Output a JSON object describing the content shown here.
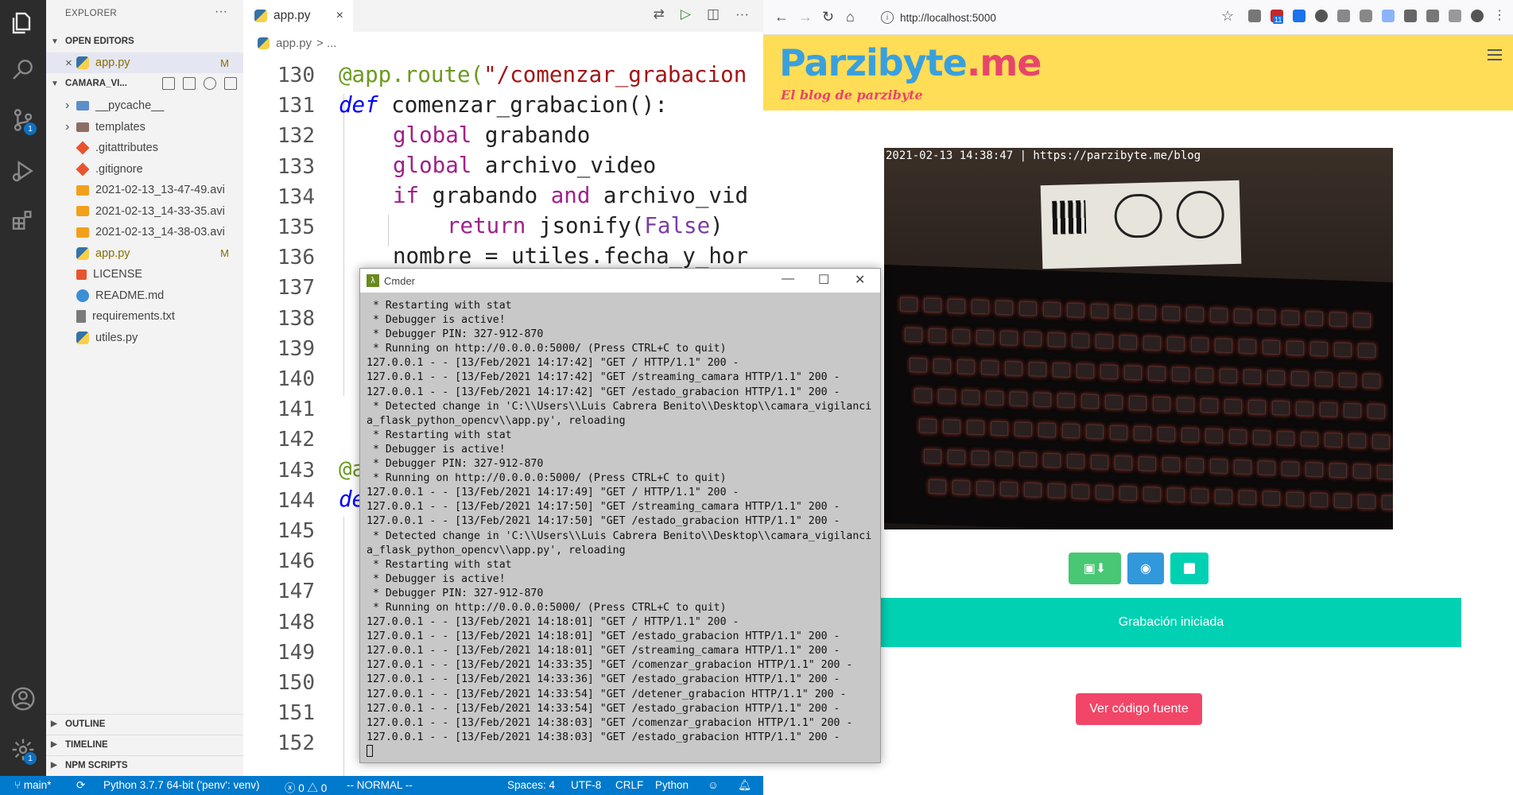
{
  "activity_bar": {
    "items": [
      {
        "icon": "files-icon",
        "active": true
      },
      {
        "icon": "search-icon"
      },
      {
        "icon": "source-control-icon",
        "badge": "1"
      },
      {
        "icon": "run-debug-icon"
      },
      {
        "icon": "extensions-icon"
      }
    ],
    "bottom": [
      {
        "icon": "account-icon"
      },
      {
        "icon": "manage-gear-icon",
        "badge": "1"
      }
    ]
  },
  "sidebar": {
    "title": "EXPLORER",
    "more": "···",
    "open_editors_label": "OPEN EDITORS",
    "open_editors": [
      {
        "name": "app.py",
        "status": "M",
        "close": "×"
      }
    ],
    "project_label": "CAMARA_VI...",
    "files": [
      {
        "name": "__pycache__",
        "type": "folder"
      },
      {
        "name": "templates",
        "type": "folder"
      },
      {
        "name": ".gitattributes",
        "type": "git"
      },
      {
        "name": ".gitignore",
        "type": "git"
      },
      {
        "name": "2021-02-13_13-47-49.avi",
        "type": "avi"
      },
      {
        "name": "2021-02-13_14-33-35.avi",
        "type": "avi"
      },
      {
        "name": "2021-02-13_14-38-03.avi",
        "type": "avi"
      },
      {
        "name": "app.py",
        "type": "py",
        "status": "M"
      },
      {
        "name": "LICENSE",
        "type": "license"
      },
      {
        "name": "README.md",
        "type": "info"
      },
      {
        "name": "requirements.txt",
        "type": "txt"
      },
      {
        "name": "utiles.py",
        "type": "py"
      }
    ],
    "outline_label": "OUTLINE",
    "timeline_label": "TIMELINE",
    "npm_label": "NPM SCRIPTS"
  },
  "editor": {
    "tab_name": "app.py",
    "tab_close": "×",
    "breadcrumb_file": "app.py",
    "breadcrumb_rest": "> ...",
    "line_numbers": [
      "130",
      "131",
      "132",
      "133",
      "134",
      "135",
      "136",
      "137",
      "138",
      "139",
      "140",
      "141",
      "142",
      "143",
      "144",
      "145",
      "146",
      "147",
      "148",
      "149",
      "150",
      "151",
      "152"
    ],
    "code": {
      "l130_a": "@app.route(",
      "l130_b": "\"/comenzar_grabacion",
      "l131_kw": "def",
      "l131_fn": " comenzar_grabacion():",
      "l132_kw": "global",
      "l132_rest": " grabando",
      "l133_kw": "global",
      "l133_rest": " archivo_video",
      "l134_kw": "if",
      "l134_a": " grabando ",
      "l134_and": "and",
      "l134_b": " archivo_vid",
      "l135_kw": "return",
      "l135_a": " jsonify(",
      "l135_false": "False",
      "l135_b": ")",
      "l136": "nombre = utiles.fecha_y_hor",
      "l143": "@a",
      "l144": "de"
    }
  },
  "cmder": {
    "title": "Cmder",
    "minimize": "—",
    "maximize": "☐",
    "close": "✕",
    "lines": [
      " * Restarting with stat",
      " * Debugger is active!",
      " * Debugger PIN: 327-912-870",
      " * Running on http://0.0.0.0:5000/ (Press CTRL+C to quit)",
      "127.0.0.1 - - [13/Feb/2021 14:17:42] \"GET / HTTP/1.1\" 200 -",
      "127.0.0.1 - - [13/Feb/2021 14:17:42] \"GET /streaming_camara HTTP/1.1\" 200 -",
      "127.0.0.1 - - [13/Feb/2021 14:17:42] \"GET /estado_grabacion HTTP/1.1\" 200 -",
      " * Detected change in 'C:\\\\Users\\\\Luis Cabrera Benito\\\\Desktop\\\\camara_vigilanci",
      "a_flask_python_opencv\\\\app.py', reloading",
      " * Restarting with stat",
      " * Debugger is active!",
      " * Debugger PIN: 327-912-870",
      " * Running on http://0.0.0.0:5000/ (Press CTRL+C to quit)",
      "127.0.0.1 - - [13/Feb/2021 14:17:49] \"GET / HTTP/1.1\" 200 -",
      "127.0.0.1 - - [13/Feb/2021 14:17:50] \"GET /streaming_camara HTTP/1.1\" 200 -",
      "127.0.0.1 - - [13/Feb/2021 14:17:50] \"GET /estado_grabacion HTTP/1.1\" 200 -",
      " * Detected change in 'C:\\\\Users\\\\Luis Cabrera Benito\\\\Desktop\\\\camara_vigilanci",
      "a_flask_python_opencv\\\\app.py', reloading",
      " * Restarting with stat",
      " * Debugger is active!",
      " * Debugger PIN: 327-912-870",
      " * Running on http://0.0.0.0:5000/ (Press CTRL+C to quit)",
      "127.0.0.1 - - [13/Feb/2021 14:18:01] \"GET / HTTP/1.1\" 200 -",
      "127.0.0.1 - - [13/Feb/2021 14:18:01] \"GET /estado_grabacion HTTP/1.1\" 200 -",
      "127.0.0.1 - - [13/Feb/2021 14:18:01] \"GET /streaming_camara HTTP/1.1\" 200 -",
      "127.0.0.1 - - [13/Feb/2021 14:33:35] \"GET /comenzar_grabacion HTTP/1.1\" 200 -",
      "127.0.0.1 - - [13/Feb/2021 14:33:36] \"GET /estado_grabacion HTTP/1.1\" 200 -",
      "127.0.0.1 - - [13/Feb/2021 14:33:54] \"GET /detener_grabacion HTTP/1.1\" 200 -",
      "127.0.0.1 - - [13/Feb/2021 14:33:54] \"GET /estado_grabacion HTTP/1.1\" 200 -",
      "127.0.0.1 - - [13/Feb/2021 14:38:03] \"GET /comenzar_grabacion HTTP/1.1\" 200 -",
      "127.0.0.1 - - [13/Feb/2021 14:38:03] \"GET /estado_grabacion HTTP/1.1\" 200 -"
    ]
  },
  "browser": {
    "url": "http://localhost:5000",
    "extension_badge": "11",
    "site": {
      "logo_main": "Parzibyte",
      "logo_tld": ".me",
      "tagline": "El blog de parzibyte",
      "video_overlay": "2021-02-13 14:38:47 | https://parzibyte.me/blog",
      "notice": "Grabación iniciada",
      "source_button": "Ver código fuente"
    },
    "colors": {
      "header": "#ffdd57",
      "green_button": "#48c774",
      "blue_button": "#3298dc",
      "teal_button": "#00d1b2",
      "notice": "#00d1b2",
      "source_button": "#f14668"
    }
  },
  "status_bar": {
    "branch": "main*",
    "interpreter": "Python 3.7.7 64-bit ('penv': venv)",
    "errors": "0",
    "warnings": "0",
    "mode": "-- NORMAL --",
    "spaces": "Spaces: 4",
    "encoding": "UTF-8",
    "eol": "CRLF",
    "language": "Python",
    "color": "#007acc"
  }
}
